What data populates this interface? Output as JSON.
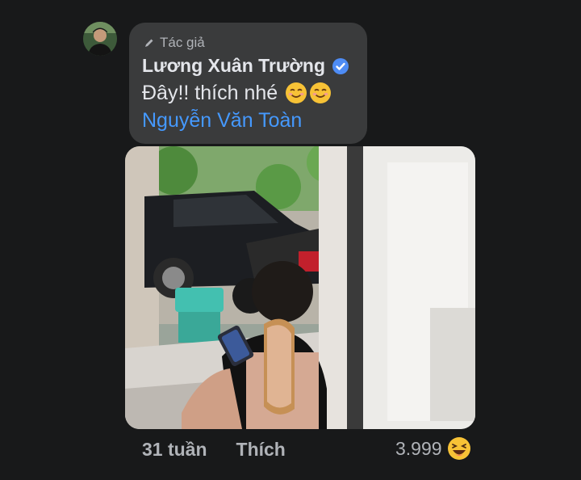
{
  "comment": {
    "author_badge": "Tác giả",
    "author_name": "Lương Xuân Trường",
    "text": "Đây!! thích nhé",
    "mention": "Nguyễn Văn Toàn"
  },
  "footer": {
    "time": "31 tuần",
    "like_label": "Thích",
    "reaction_count": "3.999"
  },
  "icons": {
    "badge": "pencil-icon",
    "verified": "verified-badge-icon",
    "emoji": "smiling-face-emoji",
    "reaction": "laughing-face-emoji"
  },
  "colors": {
    "background": "#18191a",
    "bubble": "#3a3b3c",
    "mention": "#4599ff",
    "verified": "#4e8cf5"
  }
}
